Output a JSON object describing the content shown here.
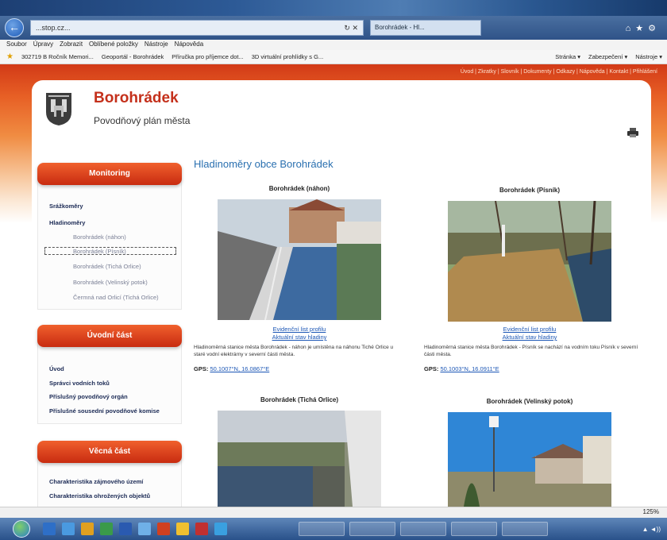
{
  "browser": {
    "url": "...stop.cz...",
    "tab_label": "Borohrádek - Hl...",
    "menu": [
      "Soubor",
      "Úpravy",
      "Zobrazit",
      "Oblíbené položky",
      "Nástroje",
      "Nápověda"
    ],
    "favorites": [
      "302719 B Ročník Memori...",
      "Geoportál - Borohrádek",
      "Příručka pro příjemce dot...",
      "3D virtuální prohlídky s G..."
    ],
    "toolbar_right": [
      "Stránka ▾",
      "Zabezpečení ▾",
      "Nástroje ▾"
    ],
    "zoom": "125%"
  },
  "site": {
    "title": "Borohrádek",
    "subtitle": "Povodňový plán města",
    "toplinks": "Úvod | Zkratky | Slovník | Dokumenty | Odkazy | Nápověda | Kontakt | Přihlášení"
  },
  "sidebar": {
    "sections": [
      {
        "heading": "Monitoring",
        "items": [
          {
            "label": "Srážkoměry",
            "style": "b"
          },
          {
            "label": "Hladinoměry",
            "style": "b"
          },
          {
            "label": "Borohrádek (náhon)",
            "style": "sub"
          },
          {
            "label": "Borohrádek (Písník)",
            "style": "sub"
          },
          {
            "label": "Borohrádek (Tichá Orlice)",
            "style": "sub"
          },
          {
            "label": "Borohrádek (Velinský potok)",
            "style": "sub"
          },
          {
            "label": "Čermná nad Orlicí (Tichá Orlice)",
            "style": "sub"
          }
        ]
      },
      {
        "heading": "Úvodní část",
        "items": [
          {
            "label": "Úvod",
            "style": "b"
          },
          {
            "label": "Správci vodních toků",
            "style": "b"
          },
          {
            "label": "Příslušný povodňový orgán",
            "style": "b"
          },
          {
            "label": "Příslušné sousední povodňové komise",
            "style": "b"
          }
        ]
      },
      {
        "heading": "Věcná část",
        "items": [
          {
            "label": "Charakteristika zájmového území",
            "style": "b"
          },
          {
            "label": "Charakteristika ohrožených objektů",
            "style": "b"
          }
        ]
      }
    ]
  },
  "main": {
    "title": "Hladinoměry obce Borohrádek",
    "stations": [
      {
        "name": "Borohrádek (náhon)",
        "link1": "Evidenční list profilu",
        "link2": "Aktuální stav hladiny",
        "description": "Hladinoměrná stanice města Borohrádek - náhon je umístěna na náhonu Tiché Orlice u staré vodní elektrárny v severní části města.",
        "gps_label": "GPS:",
        "gps": "50.1007°N, 16.0867°E"
      },
      {
        "name": "Borohrádek (Písník)",
        "link1": "Evidenční list profilu",
        "link2": "Aktuální stav hladiny",
        "description": "Hladinoměrná stanice města Borohrádek - Písník se nachází na vodním toku Písník v severní části města.",
        "gps_label": "GPS:",
        "gps": "50.1003°N, 16.0911°E"
      },
      {
        "name": "Borohrádek (Tichá Orlice)"
      },
      {
        "name": "Borohrádek (Velinský potok)"
      }
    ]
  },
  "colors": {
    "brand_red": "#c4301b",
    "title_blue": "#2a70b0",
    "link_blue": "#1b56b5"
  }
}
